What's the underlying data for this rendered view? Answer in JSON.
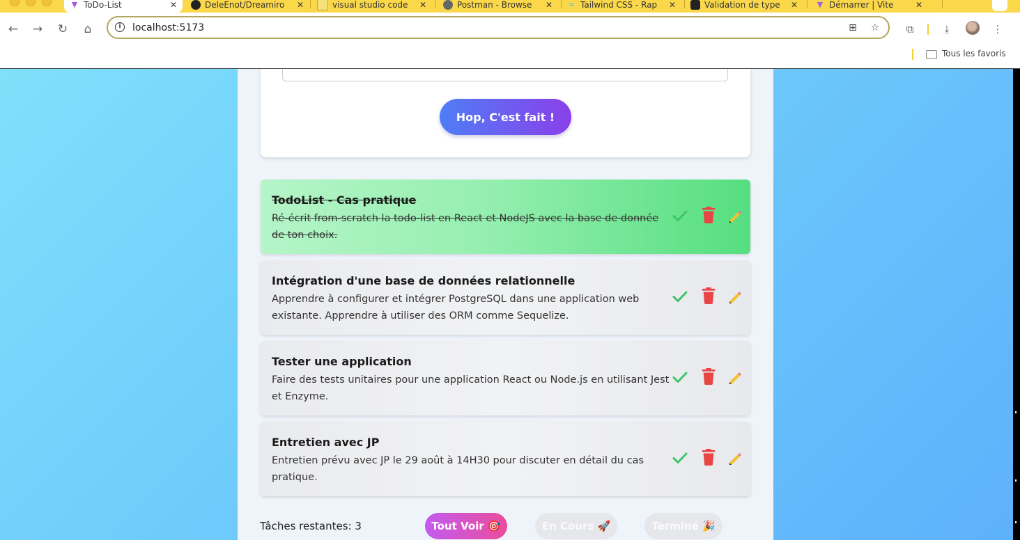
{
  "browser": {
    "tabs": [
      {
        "title": "ToDo-List",
        "active": true
      },
      {
        "title": "DeleEnot/Dreamiro"
      },
      {
        "title": "visual studio code"
      },
      {
        "title": "Postman - Browse"
      },
      {
        "title": "Tailwind CSS - Rap"
      },
      {
        "title": "Validation de type"
      },
      {
        "title": "Démarrer | Vite"
      }
    ],
    "url": "localhost:5173",
    "bookmarks_label": "Tous les favoris",
    "icons": [
      "back-icon",
      "forward-icon",
      "reload-icon",
      "home-icon",
      "site-info-icon",
      "translate-icon",
      "star-icon",
      "extensions-icon",
      "download-icon",
      "avatar",
      "kebab-menu-icon",
      "folder-icon"
    ]
  },
  "form": {
    "description_placeholder": "",
    "submit_label": "Hop, C'est fait !"
  },
  "todos": [
    {
      "title": "TodoList - Cas pratique",
      "description": "Ré-écrit from-scratch la todo-list en React et NodeJS avec la base de donnée de ton choix.",
      "completed": true
    },
    {
      "title": "Intégration d'une base de données relationnelle",
      "description": "Apprendre à configurer et intégrer PostgreSQL dans une application web existante. Apprendre à utiliser des ORM comme Sequelize.",
      "completed": false
    },
    {
      "title": "Tester une application",
      "description": "Faire des tests unitaires pour une application React ou Node.js en utilisant Jest et Enzyme.",
      "completed": false
    },
    {
      "title": "Entretien avec JP",
      "description": "Entretien prévu avec JP le 29 août à 14H30 pour discuter en détail du cas pratique.",
      "completed": false
    }
  ],
  "footer": {
    "remaining_label": "Tâches restantes: 3",
    "filters": {
      "all": "Tout Voir 🎯",
      "in_progress": "En Cours 🚀",
      "done": "Terminé 🎉"
    }
  },
  "colors": {
    "accent_gradient_start": "#4f7df6",
    "accent_gradient_end": "#8a40ea",
    "completed_green": "#56de80",
    "check_green": "#3cc56a",
    "trash_red": "#e84545",
    "filter_active": "#d458c8"
  }
}
